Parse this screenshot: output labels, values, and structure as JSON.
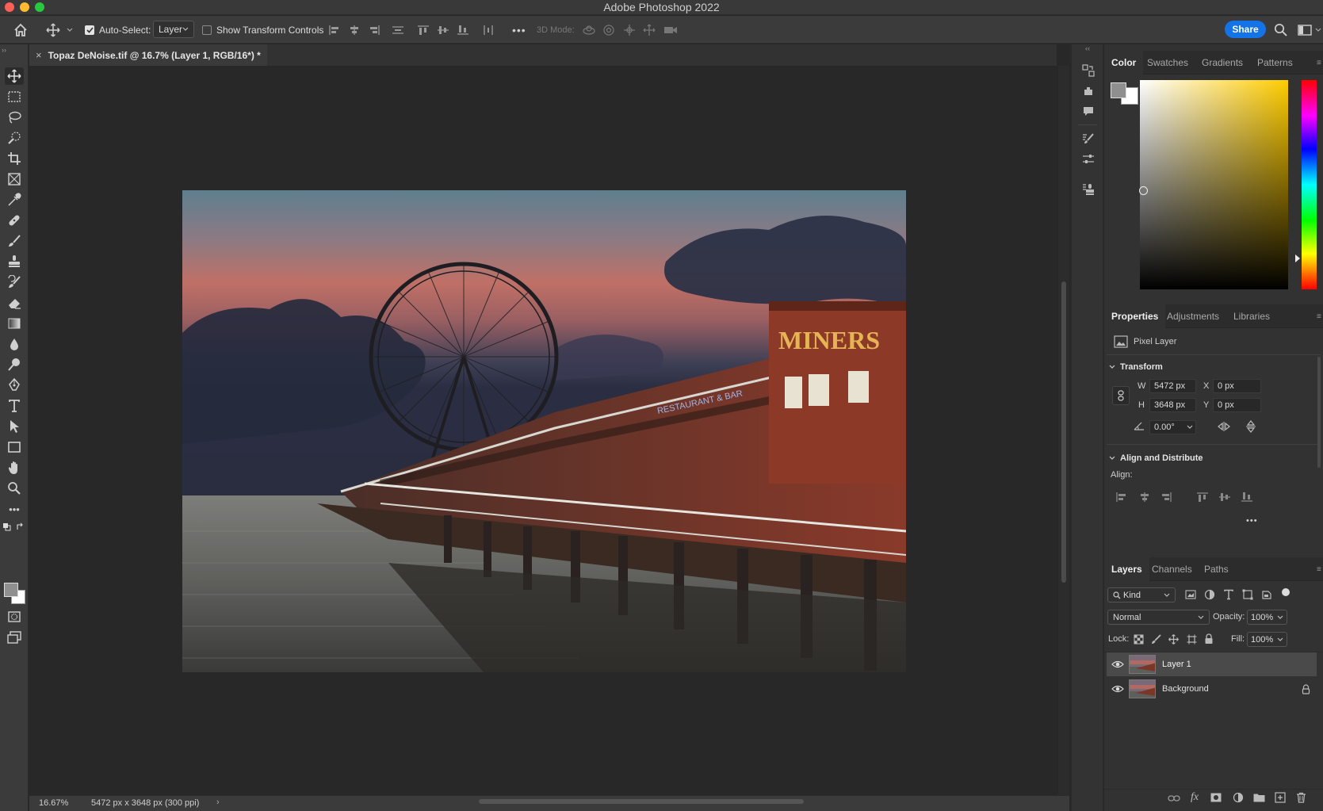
{
  "app": {
    "title": "Adobe Photoshop 2022"
  },
  "options_bar": {
    "auto_select_label": "Auto-Select:",
    "auto_select_checked": true,
    "auto_select_value": "Layer",
    "show_transform_label": "Show Transform Controls",
    "show_transform_checked": false,
    "mode_3d_label": "3D Mode:",
    "share_label": "Share"
  },
  "document": {
    "tab_title": "Topaz DeNoise.tif @ 16.7% (Layer 1, RGB/16*) *",
    "close_glyph": "×",
    "sign_text": "MINERS",
    "restaurant_text": "RESTAURANT & BAR"
  },
  "status_bar": {
    "zoom": "16.67%",
    "doc_info": "5472 px x 3648 px (300 ppi)",
    "arrow": "›"
  },
  "color_panel": {
    "tabs": [
      "Color",
      "Swatches",
      "Gradients",
      "Patterns"
    ],
    "active_tab": "Color"
  },
  "properties_panel": {
    "tabs": [
      "Properties",
      "Adjustments",
      "Libraries"
    ],
    "layer_kind": "Pixel Layer",
    "transform_title": "Transform",
    "w_label": "W",
    "w_value": "5472 px",
    "h_label": "H",
    "h_value": "3648 px",
    "x_label": "X",
    "x_value": "0 px",
    "y_label": "Y",
    "y_value": "0 px",
    "angle_value": "0.00°",
    "align_title": "Align and Distribute",
    "align_label": "Align:",
    "more": "•••"
  },
  "layers_panel": {
    "tabs": [
      "Layers",
      "Channels",
      "Paths"
    ],
    "filter_kind": "Kind",
    "blend_mode": "Normal",
    "opacity_label": "Opacity:",
    "opacity_value": "100%",
    "lock_label": "Lock:",
    "fill_label": "Fill:",
    "fill_value": "100%",
    "layers": [
      {
        "name": "Layer 1",
        "visible": true,
        "selected": true,
        "locked": false
      },
      {
        "name": "Background",
        "visible": true,
        "selected": false,
        "locked": true
      }
    ]
  },
  "colors": {
    "accent_blue": "#1473e6",
    "foreground": "#8f8f8f",
    "background": "#ffffff"
  }
}
